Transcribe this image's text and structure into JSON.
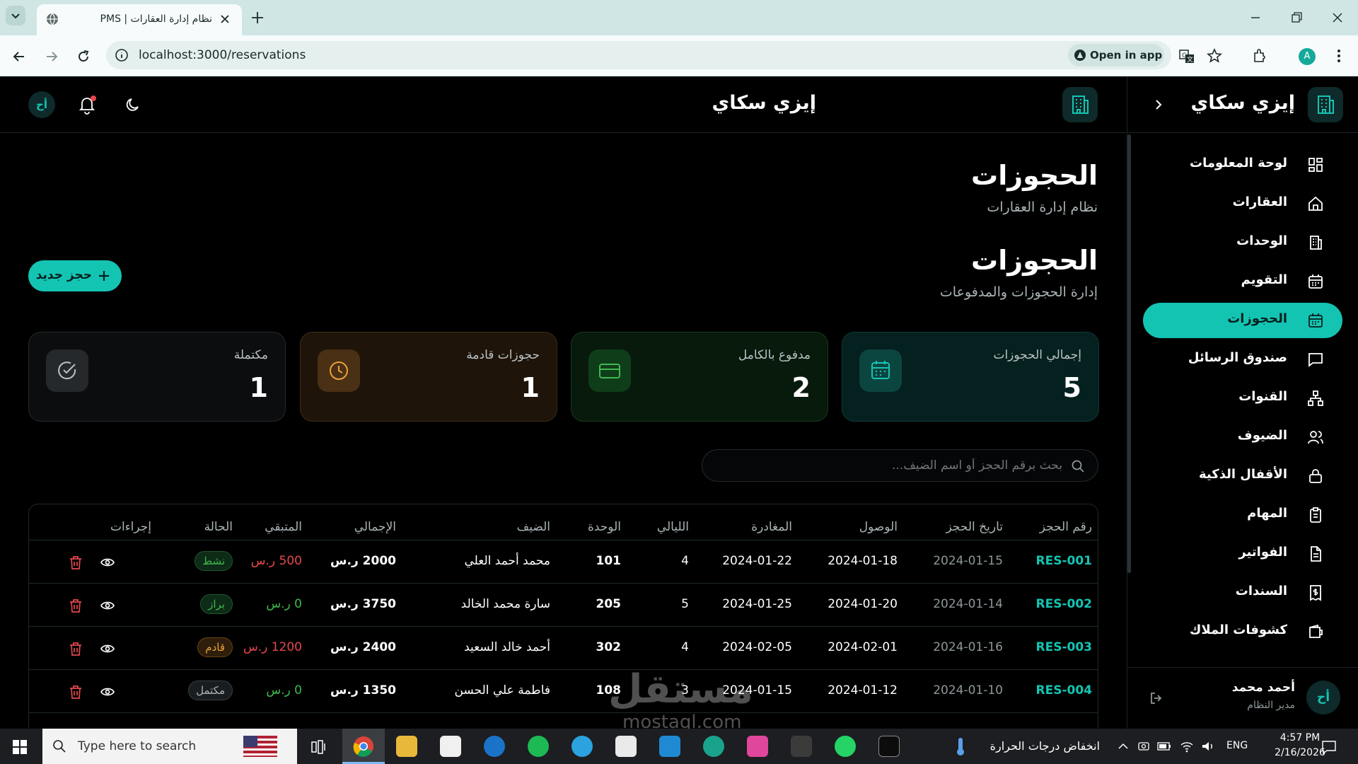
{
  "browser": {
    "tab_title": "نظام إدارة العقارات | PMS",
    "url": "localhost:3000/reservations",
    "open_in_app": "Open in app",
    "profile_initial": "A"
  },
  "topbar": {
    "brand": "إيزي سكاي",
    "avatar_initials": "أح"
  },
  "sidebar": {
    "brand": "إيزي سكاي",
    "items": [
      {
        "label": "لوحة المعلومات",
        "icon": "dashboard-icon"
      },
      {
        "label": "العقارات",
        "icon": "home-icon"
      },
      {
        "label": "الوحدات",
        "icon": "building-icon"
      },
      {
        "label": "التقويم",
        "icon": "calendar-icon"
      },
      {
        "label": "الحجوزات",
        "icon": "calendar-check-icon",
        "active": true
      },
      {
        "label": "صندوق الرسائل",
        "icon": "message-icon"
      },
      {
        "label": "القنوات",
        "icon": "network-icon"
      },
      {
        "label": "الضيوف",
        "icon": "users-icon"
      },
      {
        "label": "الأقفال الذكية",
        "icon": "lock-icon"
      },
      {
        "label": "المهام",
        "icon": "clipboard-icon"
      },
      {
        "label": "الفواتير",
        "icon": "file-icon"
      },
      {
        "label": "السندات",
        "icon": "receipt-icon"
      },
      {
        "label": "كشوفات الملاك",
        "icon": "wallet-icon"
      }
    ],
    "user": {
      "name": "أحمد محمد",
      "role": "مدير النظام",
      "initials": "أح"
    }
  },
  "page": {
    "title": "الحجوزات",
    "subtitle": "نظام إدارة العقارات",
    "section_title": "الحجوزات",
    "section_subtitle": "إدارة الحجوزات والمدفوعات",
    "new_button": "حجز جديد"
  },
  "stats": [
    {
      "label": "إجمالي الحجوزات",
      "value": "5",
      "icon": "calendar-icon"
    },
    {
      "label": "مدفوع بالكامل",
      "value": "2",
      "icon": "credit-card-icon"
    },
    {
      "label": "حجوزات قادمة",
      "value": "1",
      "icon": "clock-icon"
    },
    {
      "label": "مكتملة",
      "value": "1",
      "icon": "check-circle-icon"
    }
  ],
  "search": {
    "placeholder": "بحث برقم الحجز أو اسم الضيف..."
  },
  "table": {
    "headers": [
      "رقم الحجز",
      "تاريخ الحجز",
      "الوصول",
      "المغادرة",
      "الليالي",
      "الوحدة",
      "الضيف",
      "الإجمالي",
      "المتبقي",
      "الحالة",
      "إجراءات"
    ],
    "rows": [
      {
        "id": "RES-001",
        "booked": "2024-01-15",
        "arrival": "2024-01-18",
        "departure": "2024-01-22",
        "nights": "4",
        "unit": "101",
        "guest": "محمد أحمد العلي",
        "total": "2000 ر.س",
        "remaining": "500 ر.س",
        "status": "نشط"
      },
      {
        "id": "RES-002",
        "booked": "2024-01-14",
        "arrival": "2024-01-20",
        "departure": "2024-01-25",
        "nights": "5",
        "unit": "205",
        "guest": "سارة محمد الخالد",
        "total": "3750 ر.س",
        "remaining": "0 ر.س",
        "status": "براز"
      },
      {
        "id": "RES-003",
        "booked": "2024-01-16",
        "arrival": "2024-02-01",
        "departure": "2024-02-05",
        "nights": "4",
        "unit": "302",
        "guest": "أحمد خالد السعيد",
        "total": "2400 ر.س",
        "remaining": "1200 ر.س",
        "status": "قادم"
      },
      {
        "id": "RES-004",
        "booked": "2024-01-10",
        "arrival": "2024-01-12",
        "departure": "2024-01-15",
        "nights": "3",
        "unit": "108",
        "guest": "فاطمة علي الحسن",
        "total": "1350 ر.س",
        "remaining": "0 ر.س",
        "status": "مكتمل"
      }
    ]
  },
  "watermark": {
    "arabic": "مستقل",
    "latin": "mostaql.com"
  },
  "taskbar": {
    "search_placeholder": "Type here to search",
    "weather": "انخفاض درجات الحرارة",
    "lang": "ENG",
    "time": "4:57 PM",
    "date": "2/16/2026"
  },
  "colors": {
    "accent": "#14c4b3",
    "danger": "#e5484d",
    "success": "#3fb950",
    "warning": "#d98a2b"
  }
}
